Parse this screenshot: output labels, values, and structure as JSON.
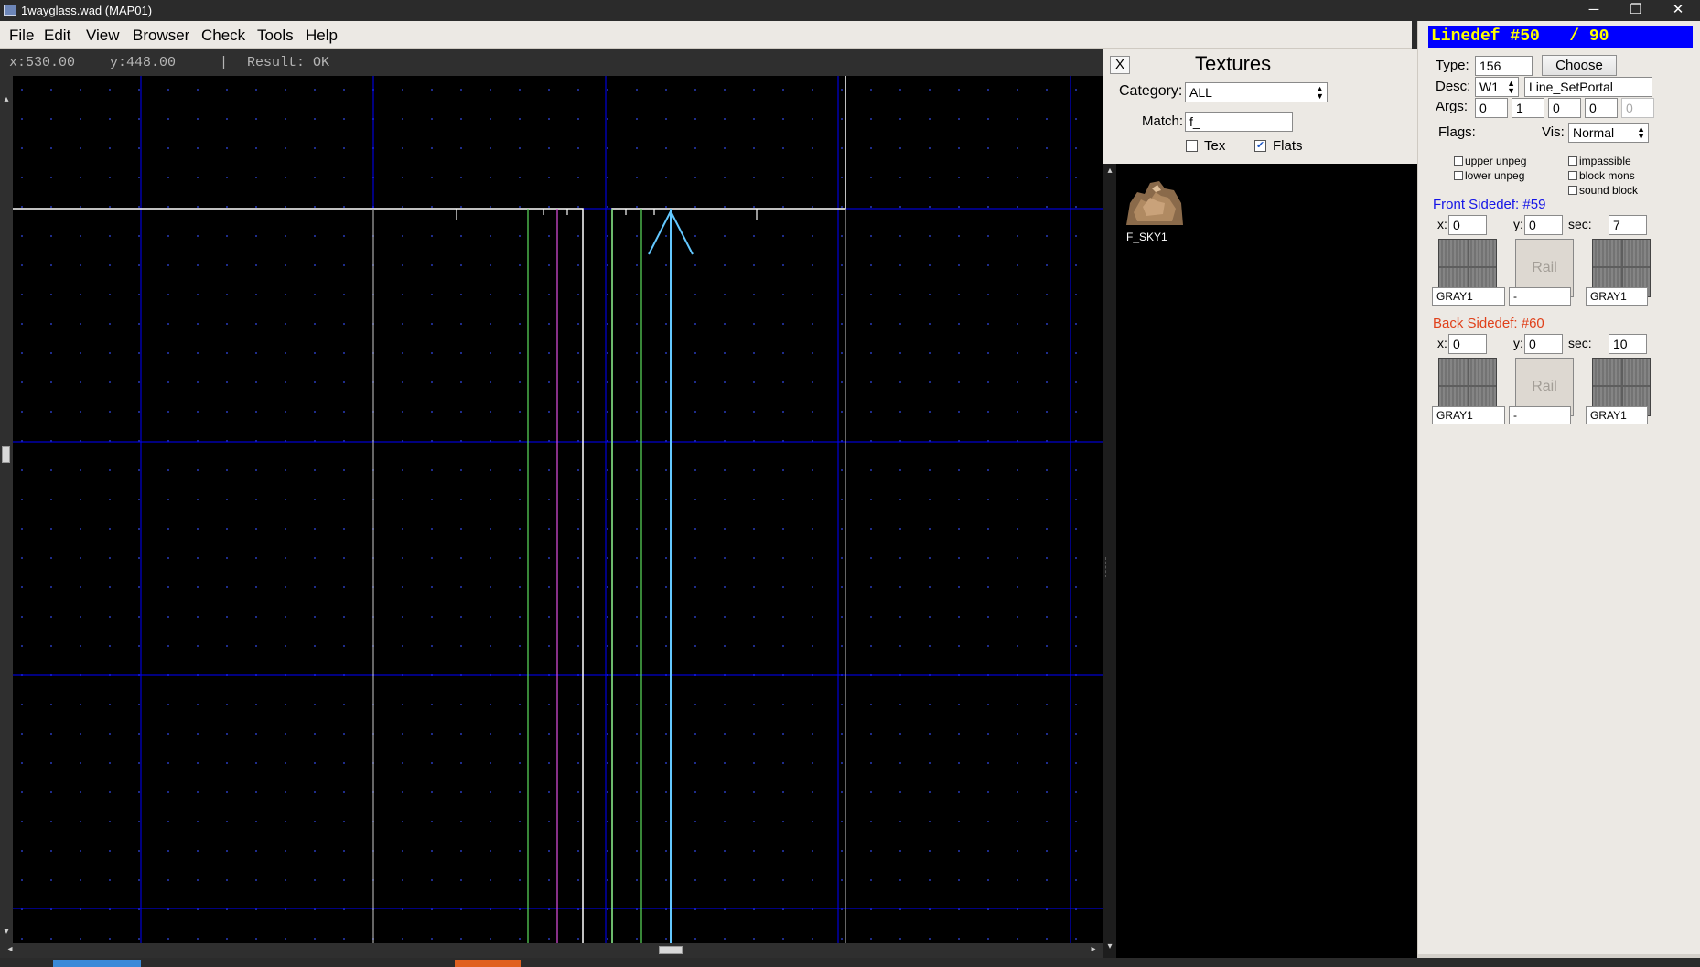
{
  "window": {
    "title": "1wayglass.wad (MAP01)",
    "controls": {
      "minimize": "─",
      "maximize": "❐",
      "close": "✕"
    }
  },
  "menu": {
    "items": [
      {
        "label": "File"
      },
      {
        "label": "Edit"
      },
      {
        "label": "View"
      },
      {
        "label": "Browser"
      },
      {
        "label": "Check"
      },
      {
        "label": "Tools"
      },
      {
        "label": "Help"
      }
    ]
  },
  "status": {
    "x": "x:530.00",
    "y": "y:448.00",
    "separator": "|",
    "result": "Result: OK"
  },
  "textures": {
    "close_label": "X",
    "title": "Textures",
    "category_label": "Category:",
    "category_value": "ALL",
    "match_label": "Match:",
    "match_value": "f_",
    "tex_label": "Tex",
    "tex_checked": false,
    "flats_label": "Flats",
    "flats_checked": true,
    "items": [
      {
        "name": "F_SKY1"
      }
    ]
  },
  "linedef": {
    "header": "Linedef #50   / 90",
    "type_label": "Type:",
    "type_value": "156",
    "choose_label": "Choose",
    "desc_label": "Desc:",
    "desc_trigger": "W1",
    "desc_value": "Line_SetPortal",
    "args_label": "Args:",
    "args": [
      "0",
      "1",
      "0",
      "0",
      "0"
    ],
    "flags_label": "Flags:",
    "vis_label": "Vis:",
    "vis_value": "Normal",
    "flags": {
      "upper_unpeg": "upper unpeg",
      "lower_unpeg": "lower unpeg",
      "impassible": "impassible",
      "block_mons": "block mons",
      "sound_block": "sound block"
    },
    "front": {
      "title": "Front Sidedef: #59",
      "color": "#1414e6",
      "x_label": "x:",
      "x": "0",
      "y_label": "y:",
      "y": "0",
      "sec_label": "sec:",
      "sec": "7",
      "upper": "GRAY1",
      "rail_label": "Rail",
      "middle": "-",
      "lower": "GRAY1"
    },
    "back": {
      "title": "Back Sidedef: #60",
      "color": "#e0401a",
      "x_label": "x:",
      "x": "0",
      "y_label": "y:",
      "y": "0",
      "sec_label": "sec:",
      "sec": "10",
      "upper": "GRAY1",
      "rail_label": "Rail",
      "middle": "-",
      "lower": "GRAY1"
    }
  },
  "colors": {
    "grid_major": "#0000ff",
    "grid_dots": "#1e2c8c",
    "line_white": "#ffffff",
    "line_green": "#5ee05e",
    "line_magenta": "#e050e0",
    "line_selected": "#63c8ff"
  }
}
